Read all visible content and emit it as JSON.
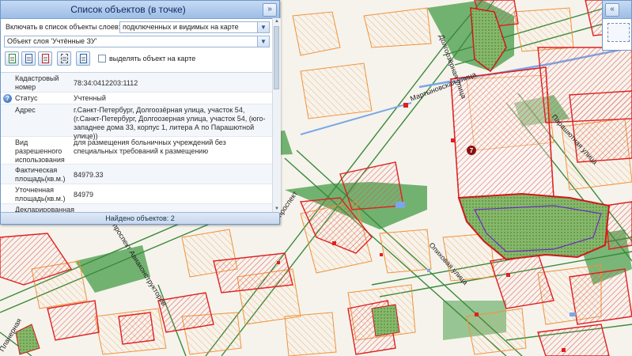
{
  "panel": {
    "title": "Список объектов (в точке)",
    "include_label": "Включать в список объекты слоев:",
    "include_value": "подключенных и видимых на карте",
    "layer_value": "Объект слоя 'Учтённые ЗУ'",
    "highlight_label": "выделять объект на карте",
    "status": "Найдено объектов: 2",
    "toolbar": [
      "doc-green-icon",
      "doc-blue-icon",
      "doc-red-icon",
      "select-area-icon",
      "table-icon"
    ]
  },
  "properties": [
    {
      "name": "Кадастровый номер",
      "value": "78:34:0412203:1112",
      "info": false
    },
    {
      "name": "Статус",
      "value": "Учтенный",
      "info": true
    },
    {
      "name": "Адрес",
      "value": "г.Санкт-Петербург, Долгоозёрная улица, участок 54, (г.Санкт-Петербург, Долгоозерная улица, участок 54, (юго-западнее дома 33, корпус 1, литера А по Парашютной улице))",
      "info": false
    },
    {
      "name": "Вид разрешенного использования",
      "value": "для размещения больничных учреждений без специальных требований к размещению",
      "info": false
    },
    {
      "name": "Фактическая площадь(кв.м.)",
      "value": "84979.33",
      "info": false
    },
    {
      "name": "Уточненная площадь(кв.м.)",
      "value": "84979",
      "info": false
    },
    {
      "name": "Декларированная",
      "value": "",
      "info": false
    }
  ],
  "map": {
    "streets": {
      "martynovskaya": "Мартыновская улица",
      "parashyutnaya": "Парашютная улица",
      "opikhovaya": "Опиховая улица",
      "aviakonstruktorov": "проспект Авиаконструкторов",
      "prospekt": "проспект",
      "dolgoozernaya": "Долгоозёрная улица",
      "plan": "Планерная"
    },
    "marker": "7"
  },
  "colors": {
    "parcel": "#e02020",
    "building": "#f0923a",
    "green": "#5aa65a",
    "road": "#3a8a3a",
    "panel_accent": "#9dbde6"
  }
}
